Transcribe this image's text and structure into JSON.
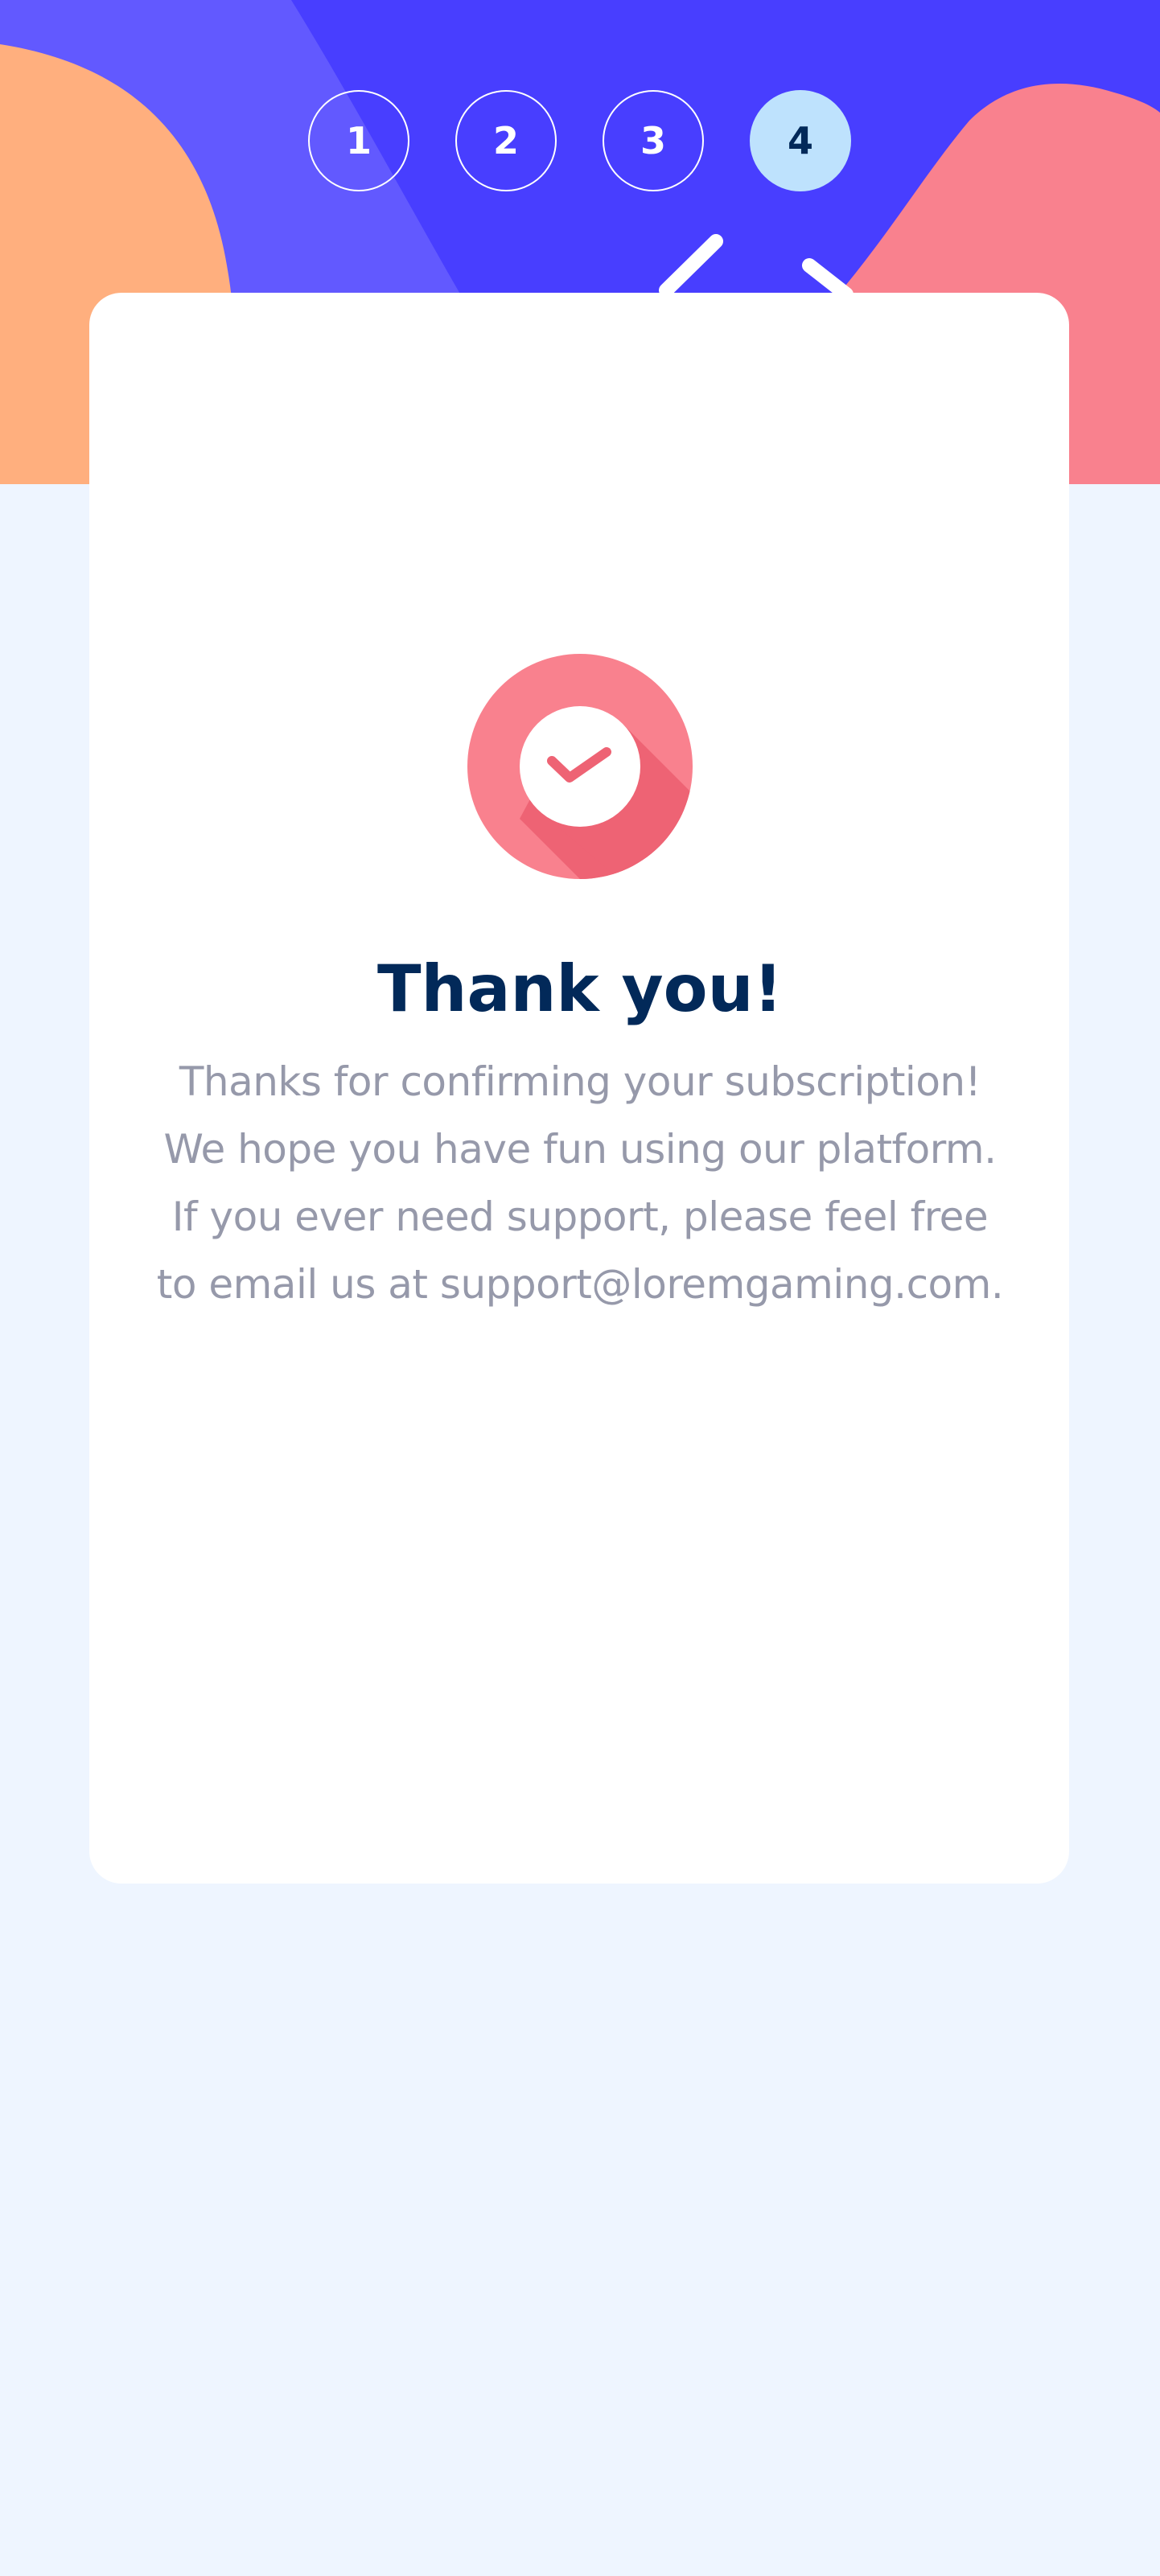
{
  "steps": {
    "items": [
      {
        "number": "1"
      },
      {
        "number": "2"
      },
      {
        "number": "3"
      },
      {
        "number": "4"
      }
    ],
    "active_step": "4"
  },
  "thank_you": {
    "title": "Thank you!",
    "message": "Thanks for confirming your subscription! We hope you have fun using our platform. If you ever need support, please feel free to email us at support@loremgaming.com."
  },
  "icons": {
    "check": "checkmark-circle-icon"
  },
  "colors": {
    "hero_purple": "#483eff",
    "hero_light_purple": "#6259ff",
    "hero_orange": "#ffaf7e",
    "hero_pink": "#f9818e",
    "active_step_bg": "#bee2fd",
    "title": "#022959",
    "text": "#9699aa",
    "page_bg": "#eef5ff"
  }
}
